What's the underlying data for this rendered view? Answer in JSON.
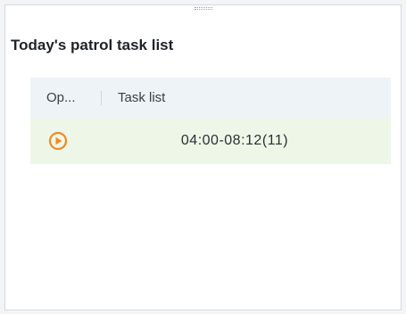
{
  "panel": {
    "title": "Today's patrol task list"
  },
  "table": {
    "columns": {
      "operation": "Op...",
      "task_list": "Task list"
    },
    "rows": [
      {
        "action_icon": "play-circle-icon",
        "task": "04:00-08:12(11)"
      }
    ]
  },
  "colors": {
    "accent": "#f08a24",
    "header_bg": "#eef3f8",
    "row_bg": "#eef6e8"
  }
}
